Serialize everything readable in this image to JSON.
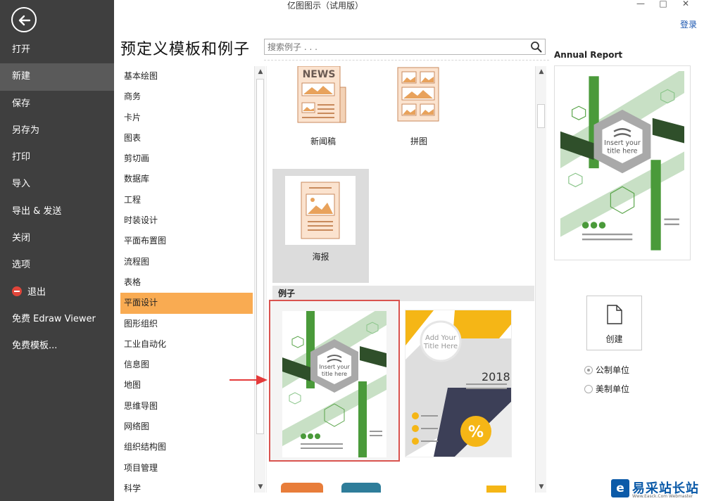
{
  "window": {
    "title": "亿图图示（试用版）",
    "login": "登录",
    "controls": [
      "—",
      "□",
      "✕"
    ]
  },
  "sidebar": {
    "items": [
      {
        "label": "打开"
      },
      {
        "label": "新建",
        "active": true
      },
      {
        "label": "保存"
      },
      {
        "label": "另存为"
      },
      {
        "label": "打印"
      },
      {
        "label": "导入"
      },
      {
        "label": "导出 & 发送"
      },
      {
        "label": "关闭"
      },
      {
        "label": "选项"
      },
      {
        "label": "退出",
        "icon": "exit-icon"
      },
      {
        "label": "免费 Edraw Viewer"
      },
      {
        "label": "免费模板..."
      }
    ]
  },
  "main": {
    "title": "预定义模板和例子",
    "search_placeholder": "搜索例子 . . ."
  },
  "categories": {
    "items": [
      "基本绘图",
      "商务",
      "卡片",
      "图表",
      "剪切画",
      "数据库",
      "工程",
      "时装设计",
      "平面布置图",
      "流程图",
      "表格",
      "平面设计",
      "图形组织",
      "工业自动化",
      "信息图",
      "地图",
      "思维导图",
      "网络图",
      "组织结构图",
      "项目管理",
      "科学"
    ],
    "active": "平面设计"
  },
  "templates": {
    "newsletter_label": "新闻稿",
    "collage_label": "拼图",
    "poster_label": "海报",
    "news_badge": "NEWS",
    "examples_header": "例子"
  },
  "examples": {
    "annual_title_line1": "Insert your",
    "annual_title_line2": "title here",
    "yellow_title_line1": "Add Your",
    "yellow_title_line2": "Title Here",
    "yellow_year": "2018",
    "yellow_percent": "%"
  },
  "right_panel": {
    "preview_title": "Annual Report",
    "create_label": "创建",
    "unit_options": [
      {
        "label": "公制单位",
        "checked": true
      },
      {
        "label": "美制单位",
        "checked": false
      }
    ]
  },
  "watermark": {
    "text": "易采站长站",
    "sub": "Www.Easck.Com Webmaster"
  },
  "colors": {
    "sidebar": "#3f3f3f",
    "accent": "#f9ab52",
    "selection_border": "#d9534f",
    "green": "#4a9a3a",
    "yellow": "#f5b616"
  }
}
